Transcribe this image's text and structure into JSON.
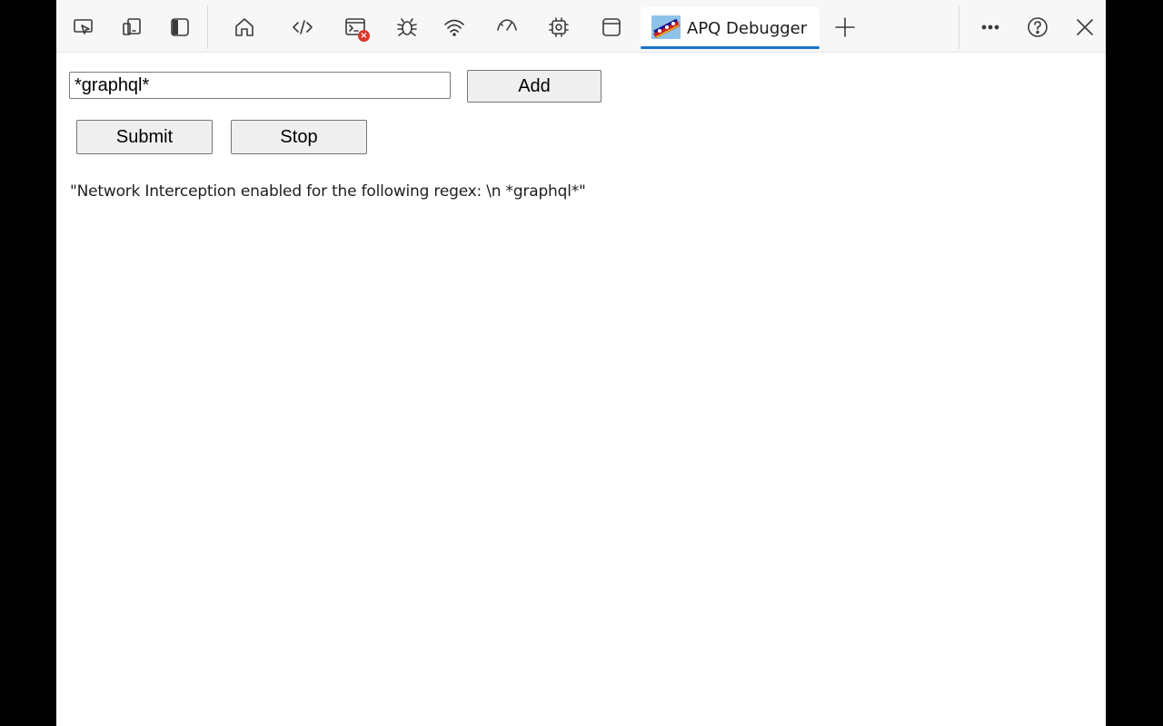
{
  "toolbar": {
    "icons": [
      "screencast-icon",
      "device-emulation-icon",
      "dock-side-icon",
      "home-icon",
      "elements-icon",
      "console-icon",
      "sources-bug-icon",
      "network-wifi-icon",
      "performance-gauge-icon",
      "memory-chip-icon",
      "application-window-icon"
    ],
    "console_badge": "×",
    "active_tab": {
      "label": "APQ Debugger",
      "logo": "apq-logo-icon"
    },
    "new_tab_icon": "plus-icon",
    "more_icon": "ellipsis-icon",
    "help_icon": "help-circle-icon",
    "close_icon": "close-icon",
    "accent": "#1a73c8",
    "badge_color": "#d9372b"
  },
  "form": {
    "regex_value": "*graphql*",
    "add_label": "Add",
    "submit_label": "Submit",
    "stop_label": "Stop"
  },
  "status": {
    "message": "\"Network Interception enabled for the following regex: \\n *graphql*\""
  }
}
